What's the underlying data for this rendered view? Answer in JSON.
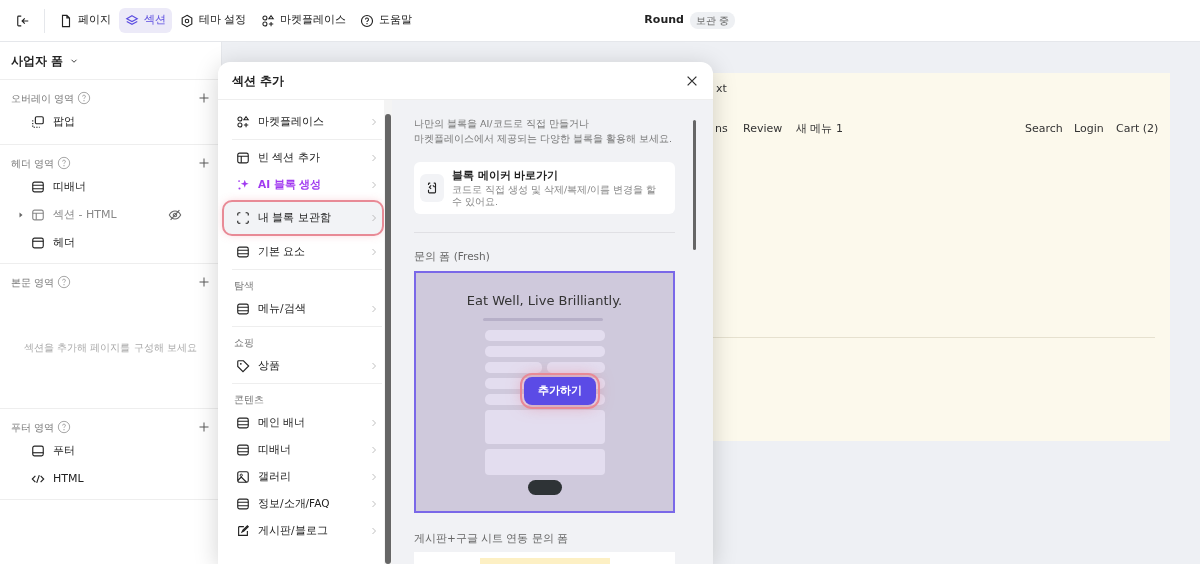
{
  "toolbar": {
    "tabs": [
      {
        "label": "페이지",
        "kind": "page",
        "selected": false
      },
      {
        "label": "섹션",
        "kind": "layers",
        "selected": true
      },
      {
        "label": "테마 설정",
        "kind": "gear",
        "selected": false
      },
      {
        "label": "마켓플레이스",
        "kind": "market",
        "selected": false
      },
      {
        "label": "도움말",
        "kind": "help",
        "selected": false
      }
    ],
    "title": "Round",
    "badge": "보관 중"
  },
  "sidebar": {
    "title": "사업자 폼",
    "sections": [
      {
        "label": "오버레이 영역",
        "items": [
          {
            "label": "팝업",
            "kind": "popup",
            "hidden": false,
            "expandable": false
          }
        ]
      },
      {
        "label": "헤더 영역",
        "items": [
          {
            "label": "띠배너",
            "kind": "banner",
            "hidden": false,
            "expandable": false
          },
          {
            "label": "섹션 - HTML",
            "kind": "layout",
            "hidden": true,
            "expandable": true
          },
          {
            "label": "헤더",
            "kind": "header",
            "hidden": false,
            "expandable": false
          }
        ]
      },
      {
        "label": "본문 영역",
        "empty_text": "섹션을 추가해 페이지를 구성해 보세요"
      },
      {
        "label": "푸터 영역",
        "items": [
          {
            "label": "푸터",
            "kind": "footer",
            "hidden": false,
            "expandable": false
          },
          {
            "label": "HTML",
            "kind": "code",
            "hidden": false,
            "expandable": false
          }
        ]
      }
    ]
  },
  "preview": {
    "texts": [
      {
        "label": "xt",
        "kind": "top"
      },
      {
        "label": "ns",
        "kind": "nav"
      },
      {
        "label": "Review",
        "kind": "nav"
      },
      {
        "label": "새 메뉴 1",
        "kind": "nav"
      },
      {
        "label": "Search",
        "kind": "right"
      },
      {
        "label": "Login",
        "kind": "right"
      },
      {
        "label": "Cart (2)",
        "kind": "right"
      }
    ]
  },
  "modal": {
    "title": "섹션 추가",
    "menu": [
      {
        "items": [
          {
            "label": "마켓플레이스",
            "kind": "market",
            "selected": false
          }
        ]
      },
      {
        "items": [
          {
            "label": "빈 섹션 추가",
            "kind": "layout",
            "selected": false
          },
          {
            "label": "AI 블록 생성",
            "kind": "ai",
            "selected": false
          },
          {
            "label": "내 블록 보관함",
            "kind": "dashed",
            "selected": true
          },
          {
            "label": "기본 요소",
            "kind": "banner",
            "selected": false
          }
        ]
      },
      {
        "heading": "탐색",
        "items": [
          {
            "label": "메뉴/검색",
            "kind": "banner",
            "selected": false
          }
        ]
      },
      {
        "heading": "쇼핑",
        "items": [
          {
            "label": "상품",
            "kind": "tag",
            "selected": false
          }
        ]
      },
      {
        "heading": "콘텐츠",
        "items": [
          {
            "label": "메인 배너",
            "kind": "banner",
            "selected": false
          },
          {
            "label": "띠배너",
            "kind": "banner",
            "selected": false
          },
          {
            "label": "갤러리",
            "kind": "image",
            "selected": false
          },
          {
            "label": "정보/소개/FAQ",
            "kind": "banner",
            "selected": false
          },
          {
            "label": "게시판/블로그",
            "kind": "edit",
            "selected": false
          }
        ]
      }
    ],
    "intro": "나만의 블록을 AI/코드로 직접 만들거나\n마켓플레이스에서 제공되는 다양한 블록을 활용해 보세요.",
    "shortcut": {
      "title": "블록 메이커 바로가기",
      "description": "코드로 직접 생성 및 삭제/복제/이름 변경을 할 수 있어요."
    },
    "blocks": [
      {
        "title": "문의 폼 (Fresh)",
        "preview_title": "Eat Well, Live Brilliantly.",
        "add_button": "추가하기",
        "selected": true
      },
      {
        "title": "게시판+구글 시트 연동 문의 폼",
        "selected": false
      }
    ]
  }
}
